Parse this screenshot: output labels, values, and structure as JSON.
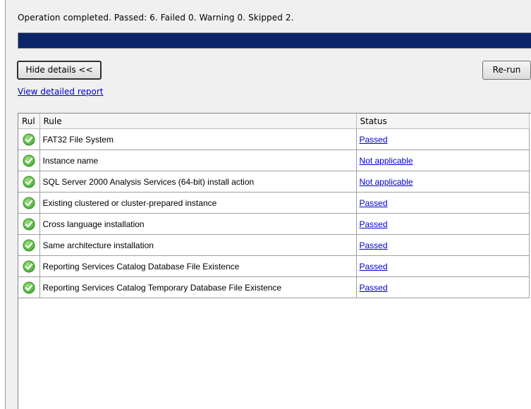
{
  "summary": {
    "text": "Operation completed. Passed: 6.   Failed 0.   Warning 0.   Skipped 2."
  },
  "progress": {
    "fraction": 1.0,
    "color": "#0a246a"
  },
  "buttons": {
    "hide_details": "Hide details <<",
    "rerun": "Re-run"
  },
  "links": {
    "view_report": "View detailed report"
  },
  "table": {
    "headers": [
      "Rul",
      "Rule",
      "Status"
    ],
    "rows": [
      {
        "icon": "passed-check-icon",
        "rule": "FAT32 File System",
        "status": "Passed"
      },
      {
        "icon": "passed-check-icon",
        "rule": "Instance name",
        "status": "Not applicable"
      },
      {
        "icon": "passed-check-icon",
        "rule": "SQL Server 2000 Analysis Services (64-bit) install action",
        "status": "Not applicable"
      },
      {
        "icon": "passed-check-icon",
        "rule": "Existing clustered or cluster-prepared instance",
        "status": "Passed"
      },
      {
        "icon": "passed-check-icon",
        "rule": "Cross language installation",
        "status": "Passed"
      },
      {
        "icon": "passed-check-icon",
        "rule": "Same architecture installation",
        "status": "Passed"
      },
      {
        "icon": "passed-check-icon",
        "rule": "Reporting Services Catalog Database File Existence",
        "status": "Passed"
      },
      {
        "icon": "passed-check-icon",
        "rule": "Reporting Services Catalog Temporary Database File Existence",
        "status": "Passed"
      }
    ]
  },
  "colors": {
    "link": "#0000cc",
    "check_green": "#4caf3a"
  }
}
